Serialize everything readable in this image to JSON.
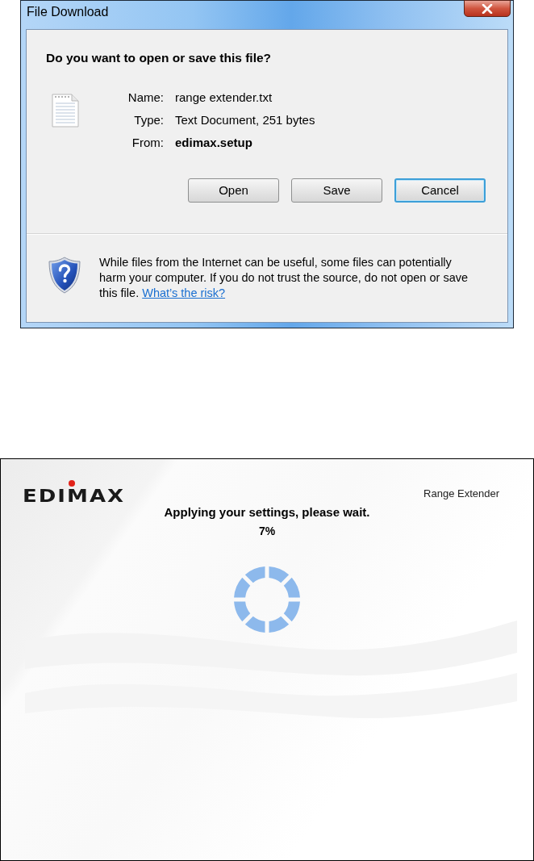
{
  "dialog": {
    "title": "File Download",
    "question": "Do you want to open or save this file?",
    "fields": [
      {
        "label": "Name:",
        "value": "range extender.txt",
        "bold": false
      },
      {
        "label": "Type:",
        "value": "Text Document, 251 bytes",
        "bold": false
      },
      {
        "label": "From:",
        "value": "edimax.setup",
        "bold": true
      }
    ],
    "buttons": [
      {
        "label": "Open",
        "focused": false
      },
      {
        "label": "Save",
        "focused": false
      },
      {
        "label": "Cancel",
        "focused": true
      }
    ],
    "warning": {
      "text": "While files from the Internet can be useful, some files can potentially harm your computer. If you do not trust the source, do not open or save this file.",
      "link": "What’s the risk?"
    }
  },
  "setup_page": {
    "logo": "EDIMAX",
    "product": "Range Extender",
    "status": "Applying your settings, please wait.",
    "progress": "7%"
  }
}
